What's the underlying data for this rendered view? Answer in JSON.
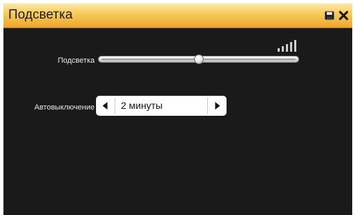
{
  "window": {
    "title": "Подсветка"
  },
  "toolbar": {
    "save_icon": "save-icon",
    "close_icon": "close-icon"
  },
  "backlight": {
    "label": "Подсветка",
    "level": 0.5,
    "signal_icon": "signal-strength-icon"
  },
  "auto_off": {
    "label": "Автовыключение",
    "value": "2 минуты",
    "prev_icon": "triangle-left-icon",
    "next_icon": "triangle-right-icon"
  },
  "colors": {
    "titlebar_accent": "#f6c85a",
    "background": "#1a1a1a",
    "label_text": "#e9e9e9"
  }
}
